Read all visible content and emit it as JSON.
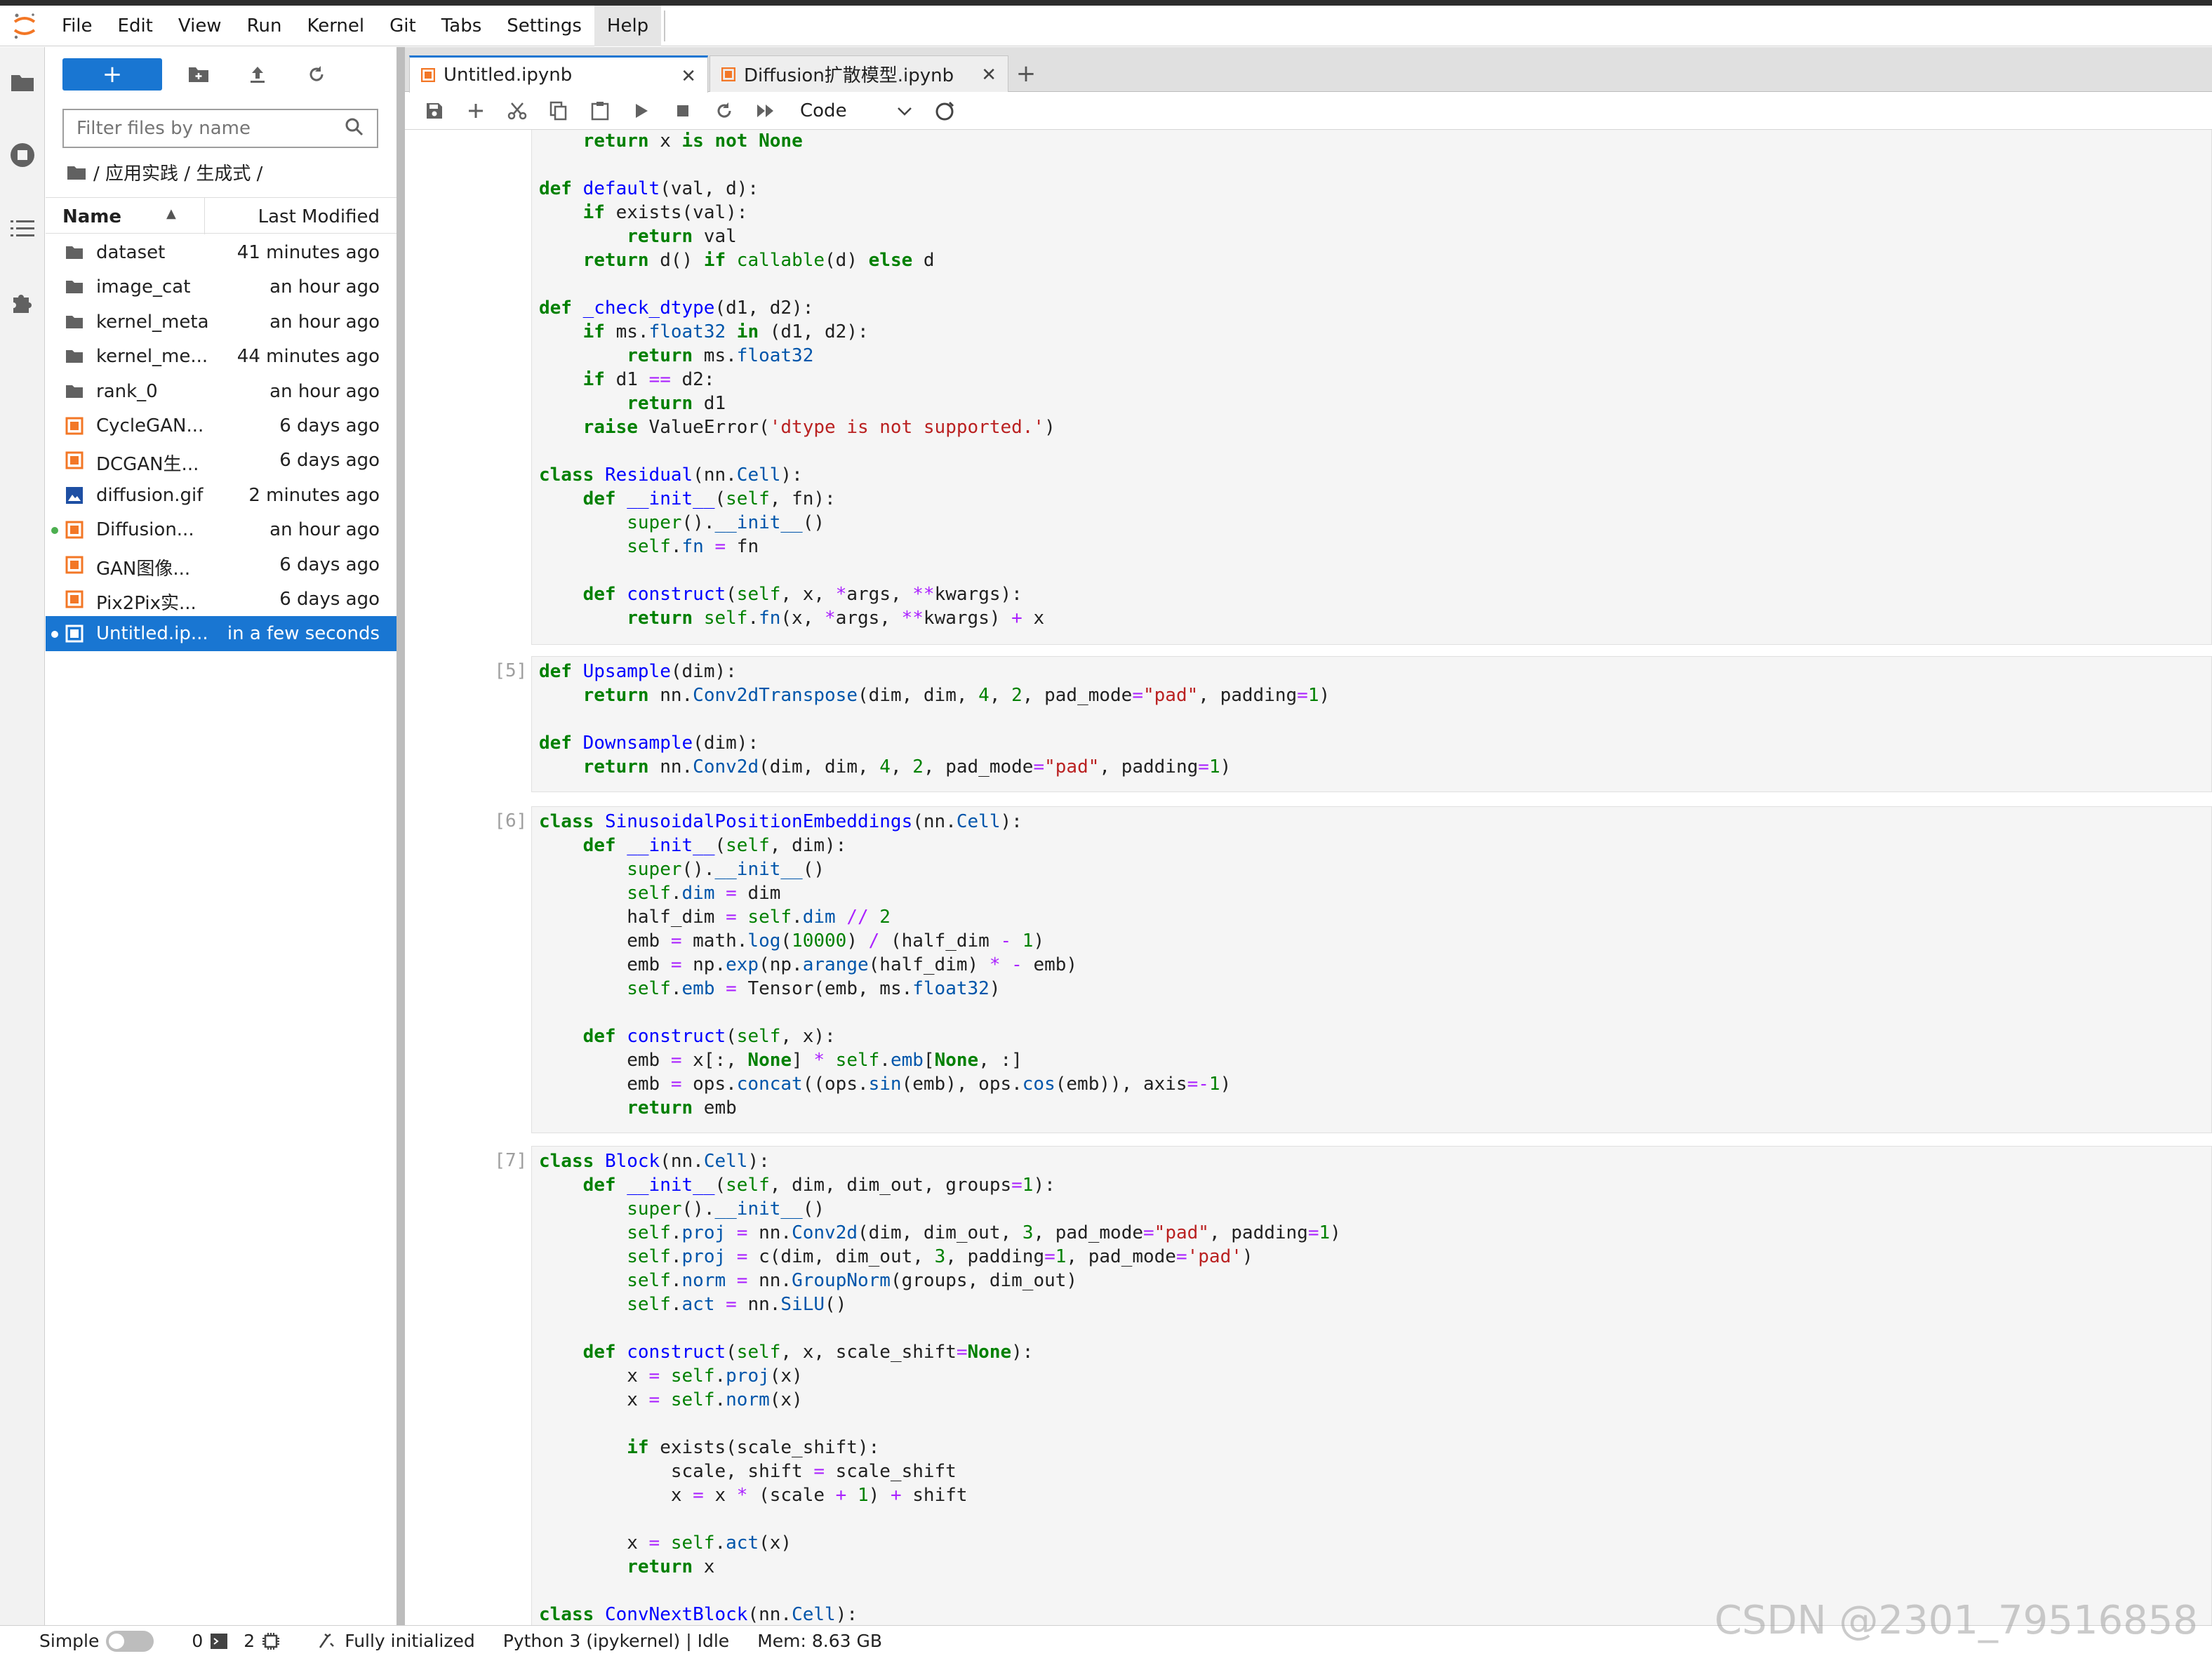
{
  "menubar": {
    "items": [
      "File",
      "Edit",
      "View",
      "Run",
      "Kernel",
      "Git",
      "Tabs",
      "Settings",
      "Help"
    ],
    "active_index": 8
  },
  "filebrowser": {
    "new_label": "+",
    "filter_placeholder": "Filter files by name",
    "breadcrumb": "/ 应用实践 / 生成式 /",
    "header": {
      "name": "Name",
      "modified": "Last Modified"
    },
    "files": [
      {
        "name": "dataset",
        "modified": "41 minutes ago",
        "type": "folder",
        "running": false,
        "selected": false
      },
      {
        "name": "image_cat",
        "modified": "an hour ago",
        "type": "folder",
        "running": false,
        "selected": false
      },
      {
        "name": "kernel_meta",
        "modified": "an hour ago",
        "type": "folder",
        "running": false,
        "selected": false
      },
      {
        "name": "kernel_me...",
        "modified": "44 minutes ago",
        "type": "folder",
        "running": false,
        "selected": false
      },
      {
        "name": "rank_0",
        "modified": "an hour ago",
        "type": "folder",
        "running": false,
        "selected": false
      },
      {
        "name": "CycleGAN...",
        "modified": "6 days ago",
        "type": "notebook",
        "running": false,
        "selected": false
      },
      {
        "name": "DCGAN生...",
        "modified": "6 days ago",
        "type": "notebook",
        "running": false,
        "selected": false
      },
      {
        "name": "diffusion.gif",
        "modified": "2 minutes ago",
        "type": "image",
        "running": false,
        "selected": false
      },
      {
        "name": "Diffusion...",
        "modified": "an hour ago",
        "type": "notebook",
        "running": true,
        "selected": false
      },
      {
        "name": "GAN图像...",
        "modified": "6 days ago",
        "type": "notebook",
        "running": false,
        "selected": false
      },
      {
        "name": "Pix2Pix实...",
        "modified": "6 days ago",
        "type": "notebook",
        "running": false,
        "selected": false
      },
      {
        "name": "Untitled.ip...",
        "modified": "in a few seconds",
        "type": "notebook",
        "running": true,
        "selected": true
      }
    ]
  },
  "tabs": [
    {
      "label": "Untitled.ipynb",
      "active": true
    },
    {
      "label": "Diffusion扩散模型.ipynb",
      "active": false
    }
  ],
  "notebook_toolbar": {
    "cell_type": "Code"
  },
  "cells": [
    {
      "prompt": "",
      "lines": [
        "    return x is not None",
        "",
        "def default(val, d):",
        "    if exists(val):",
        "        return val",
        "    return d() if callable(d) else d",
        "",
        "def _check_dtype(d1, d2):",
        "    if ms.float32 in (d1, d2):",
        "        return ms.float32",
        "    if d1 == d2:",
        "        return d1",
        "    raise ValueError('dtype is not supported.')",
        "",
        "class Residual(nn.Cell):",
        "    def __init__(self, fn):",
        "        super().__init__()",
        "        self.fn = fn",
        "",
        "    def construct(self, x, *args, **kwargs):",
        "        return self.fn(x, *args, **kwargs) + x"
      ]
    },
    {
      "prompt": "[5]:",
      "lines": [
        "def Upsample(dim):",
        "    return nn.Conv2dTranspose(dim, dim, 4, 2, pad_mode=\"pad\", padding=1)",
        "",
        "def Downsample(dim):",
        "    return nn.Conv2d(dim, dim, 4, 2, pad_mode=\"pad\", padding=1)"
      ]
    },
    {
      "prompt": "[6]:",
      "lines": [
        "class SinusoidalPositionEmbeddings(nn.Cell):",
        "    def __init__(self, dim):",
        "        super().__init__()",
        "        self.dim = dim",
        "        half_dim = self.dim // 2",
        "        emb = math.log(10000) / (half_dim - 1)",
        "        emb = np.exp(np.arange(half_dim) * - emb)",
        "        self.emb = Tensor(emb, ms.float32)",
        "",
        "    def construct(self, x):",
        "        emb = x[:, None] * self.emb[None, :]",
        "        emb = ops.concat((ops.sin(emb), ops.cos(emb)), axis=-1)",
        "        return emb"
      ]
    },
    {
      "prompt": "[7]:",
      "lines": [
        "class Block(nn.Cell):",
        "    def __init__(self, dim, dim_out, groups=1):",
        "        super().__init__()",
        "        self.proj = nn.Conv2d(dim, dim_out, 3, pad_mode=\"pad\", padding=1)",
        "        self.proj = c(dim, dim_out, 3, padding=1, pad_mode='pad')",
        "        self.norm = nn.GroupNorm(groups, dim_out)",
        "        self.act = nn.SiLU()",
        "",
        "    def construct(self, x, scale_shift=None):",
        "        x = self.proj(x)",
        "        x = self.norm(x)",
        "",
        "        if exists(scale_shift):",
        "            scale, shift = scale_shift",
        "            x = x * (scale + 1) + shift",
        "",
        "        x = self.act(x)",
        "        return x",
        "",
        "class ConvNextBlock(nn.Cell):"
      ]
    }
  ],
  "statusbar": {
    "mode": "Simple",
    "terminals": "0",
    "kernels": "2",
    "status": "Fully initialized",
    "kernel": "Python 3 (ipykernel) | Idle",
    "mem": "Mem: 8.63 GB"
  },
  "watermark": "CSDN @2301_79516858",
  "colors": {
    "accent": "#1976d2",
    "notebook_icon": "#f37726",
    "running_dot": "#4caf50"
  },
  "icons": {
    "activity": [
      "folder-icon",
      "stop-circle-icon",
      "list-icon",
      "puzzle-icon"
    ],
    "toolbar": [
      "save-icon",
      "add-icon",
      "cut-icon",
      "copy-icon",
      "paste-icon",
      "run-icon",
      "stop-icon",
      "restart-icon",
      "fast-forward-icon"
    ]
  }
}
